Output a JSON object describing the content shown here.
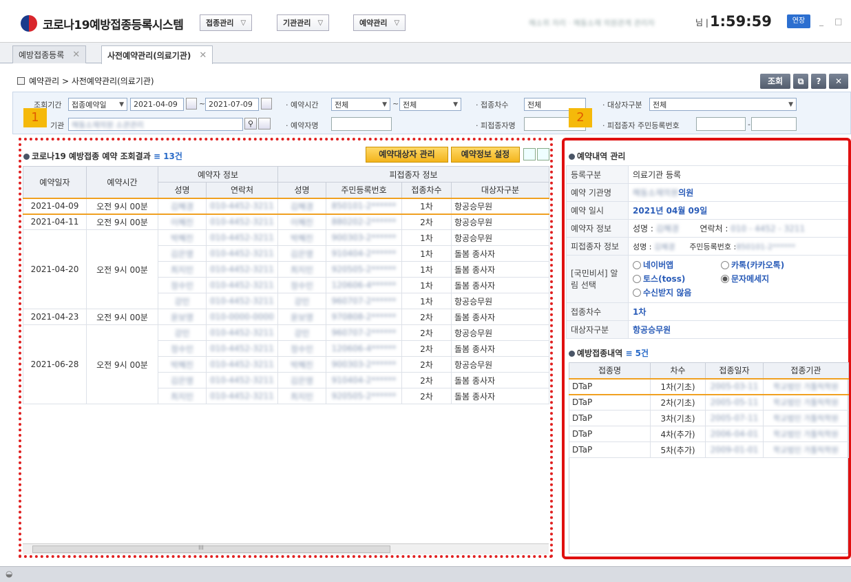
{
  "header": {
    "app_title": "코로나19예방접종등록시스템",
    "menus": [
      "접종관리",
      "기관관리",
      "예약관리"
    ],
    "user_info": "해소위 자리 · 해동소재 의원관계 관리자",
    "user_suffix": "님 |",
    "timer": "1:59:59",
    "extend_label": "연장"
  },
  "tabs": [
    {
      "label": "예방접종등록",
      "active": false
    },
    {
      "label": "사전예약관리(의료기관)",
      "active": true
    }
  ],
  "breadcrumb": "예약관리 > 사전예약관리(의료기관)",
  "toolbar": {
    "search_label": "조회"
  },
  "search": {
    "period_label": "조회기간",
    "period_type": "접종예약일",
    "date_from": "2021-04-09",
    "date_to": "2021-07-09",
    "tilde": "~",
    "time_label": "· 예약시간",
    "time_from": "전체",
    "time_to": "전체",
    "round_label": "· 접종차수",
    "round_value": "전체",
    "target_label": "· 대상자구분",
    "target_value": "전체",
    "org_label": "기관",
    "org_value": "해동소재의원 소관관리",
    "reserver_label": "· 예약자명",
    "recipient_label": "· 피접종자명",
    "rrn_label": "· 피접종자 주민등록번호",
    "rrn_dash": "-"
  },
  "markers": {
    "left": "1",
    "right": "2"
  },
  "results": {
    "title": "코로나19 예방접종 예약 조회결과",
    "count": "13건",
    "btn_manage": "예약대상자 관리",
    "btn_setting": "예약정보 설정",
    "headers": {
      "date": "예약일자",
      "time": "예약시간",
      "reserver": "예약자 정보",
      "name": "성명",
      "phone": "연락처",
      "recipient": "피접종자 정보",
      "rname": "성명",
      "rrn": "주민등록번호",
      "round": "접종차수",
      "target": "대상자구분"
    },
    "groups": [
      {
        "date": "2021-04-09",
        "time": "오전 9시 00분",
        "rows": [
          {
            "name": "김혜경",
            "phone": "010-4452-3211",
            "rname": "김혜경",
            "rrn": "850101-2******",
            "round": "1차",
            "target": "항공승무원"
          }
        ]
      },
      {
        "date": "2021-04-11",
        "time": "오전 9시 00분",
        "rows": [
          {
            "name": "이혜진",
            "phone": "010-4452-3211",
            "rname": "이혜진",
            "rrn": "880202-2******",
            "round": "2차",
            "target": "항공승무원"
          }
        ]
      },
      {
        "date": "2021-04-20",
        "time": "오전 9시 00분",
        "rows": [
          {
            "name": "박혜진",
            "phone": "010-4452-3211",
            "rname": "박혜진",
            "rrn": "900303-2******",
            "round": "1차",
            "target": "항공승무원"
          },
          {
            "name": "김은영",
            "phone": "010-4452-3211",
            "rname": "김은영",
            "rrn": "910404-2******",
            "round": "1차",
            "target": "돌봄 종사자"
          },
          {
            "name": "최지민",
            "phone": "010-4452-3211",
            "rname": "최지민",
            "rrn": "920505-2******",
            "round": "1차",
            "target": "돌봄 종사자"
          },
          {
            "name": "정수민",
            "phone": "010-4452-3211",
            "rname": "정수민",
            "rrn": "120606-4******",
            "round": "1차",
            "target": "돌봄 종사자"
          },
          {
            "name": "강민",
            "phone": "010-4452-3211",
            "rname": "강민",
            "rrn": "960707-2******",
            "round": "1차",
            "target": "항공승무원"
          }
        ]
      },
      {
        "date": "2021-04-23",
        "time": "오전 9시 00분",
        "rows": [
          {
            "name": "윤보영",
            "phone": "010-0000-0000",
            "rname": "윤보영",
            "rrn": "970808-2******",
            "round": "2차",
            "target": "돌봄 종사자"
          }
        ]
      },
      {
        "date": "2021-06-28",
        "time": "오전 9시 00분",
        "rows": [
          {
            "name": "강민",
            "phone": "010-4452-3211",
            "rname": "강민",
            "rrn": "960707-2******",
            "round": "2차",
            "target": "항공승무원"
          },
          {
            "name": "정수민",
            "phone": "010-4452-3211",
            "rname": "정수민",
            "rrn": "120606-4******",
            "round": "2차",
            "target": "돌봄 종사자"
          },
          {
            "name": "박혜진",
            "phone": "010-4452-3211",
            "rname": "박혜진",
            "rrn": "900303-2******",
            "round": "2차",
            "target": "항공승무원"
          },
          {
            "name": "김은영",
            "phone": "010-4452-3211",
            "rname": "김은영",
            "rrn": "910404-2******",
            "round": "2차",
            "target": "돌봄 종사자"
          },
          {
            "name": "최지민",
            "phone": "010-4452-3211",
            "rname": "최지민",
            "rrn": "920505-2******",
            "round": "2차",
            "target": "돌봄 종사자"
          }
        ]
      }
    ]
  },
  "detail": {
    "title": "예약내역 관리",
    "reg_type_label": "등록구분",
    "reg_type": "의료기관 등록",
    "org_label": "예약 기관명",
    "org_blur": "해동소재의원",
    "org_suffix": "의원",
    "date_label": "예약 일시",
    "date": "2021년 04월 09일",
    "reserver_label": "예약자 정보",
    "name_prefix": "성명 :",
    "name_val": "김혜경",
    "phone_prefix": "연락처 :",
    "phone_val": "010 - 4452 - 3211",
    "recipient_label": "피접종자 정보",
    "rrn_prefix": "주민등록번호 :",
    "rrn_val": "850101-2******",
    "notify_label": "[국민비서] 알림 선택",
    "notify_options": [
      "네이버앱",
      "카톡(카카오톡)",
      "토스(toss)",
      "문자메세지",
      "수신받지 않음"
    ],
    "notify_selected": "문자메세지",
    "round_label": "접종차수",
    "round": "1차",
    "target_label": "대상자구분",
    "target": "항공승무원"
  },
  "history": {
    "title": "예방접종내역",
    "count": "5건",
    "headers": [
      "접종명",
      "차수",
      "접종일자",
      "접종기관"
    ],
    "rows": [
      {
        "name": "DTaP",
        "round": "1차(기초)",
        "date": "2005-03-11",
        "org": "학교법인 가톨릭학원"
      },
      {
        "name": "DTaP",
        "round": "2차(기초)",
        "date": "2005-05-11",
        "org": "학교법인 가톨릭학원"
      },
      {
        "name": "DTaP",
        "round": "3차(기초)",
        "date": "2005-07-11",
        "org": "학교법인 가톨릭학원"
      },
      {
        "name": "DTaP",
        "round": "4차(추가)",
        "date": "2006-04-01",
        "org": "학교법인 가톨릭학원"
      },
      {
        "name": "DTaP",
        "round": "5차(추가)",
        "date": "2009-01-01",
        "org": "학교법인 가톨릭학원"
      }
    ]
  },
  "scrollbar": {
    "grip": "III"
  },
  "colors": {
    "accent": "#2c6fd0",
    "highlight": "#f0a020",
    "marker": "#f5b90a",
    "frame": "#e02020"
  }
}
